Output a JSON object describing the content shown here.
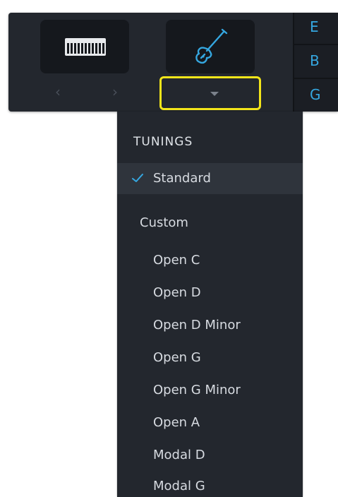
{
  "toolbar": {
    "instruments": [
      {
        "name": "keyboard",
        "icon": "piano-keys-icon"
      },
      {
        "name": "guitar",
        "icon": "electric-guitar-icon"
      }
    ],
    "prev_arrow": "‹",
    "next_arrow": "›",
    "strings": [
      "E",
      "B",
      "G"
    ],
    "accent_color": "#35a7e0"
  },
  "dropdown": {
    "header": "TUNINGS",
    "selected": "Standard",
    "group_label": "Custom",
    "custom_items": [
      "Open C",
      "Open D",
      "Open D Minor",
      "Open G",
      "Open G Minor",
      "Open A",
      "Modal D",
      "Modal G"
    ]
  },
  "highlight_color": "#f3e51a"
}
